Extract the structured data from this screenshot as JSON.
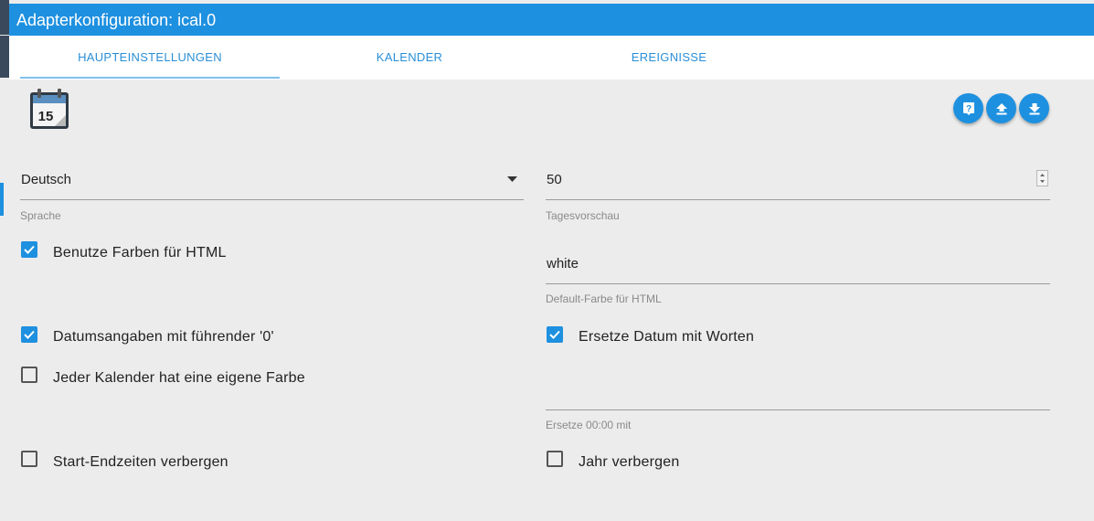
{
  "window": {
    "title": "Adapterkonfiguration: ical.0"
  },
  "tabs": [
    {
      "label": "HAUPTEINSTELLUNGEN",
      "active": true
    },
    {
      "label": "KALENDER",
      "active": false
    },
    {
      "label": "EREIGNISSE",
      "active": false
    }
  ],
  "logo": {
    "icon": "calendar-icon",
    "day": "15"
  },
  "toolbar": {
    "buttons": [
      {
        "icon": "help-icon"
      },
      {
        "icon": "upload-icon"
      },
      {
        "icon": "download-icon"
      }
    ]
  },
  "settings": {
    "language": {
      "value": "Deutsch",
      "helper": "Sprache"
    },
    "days_preview": {
      "value": "50",
      "helper": "Tagesvorschau"
    },
    "use_colors": {
      "label": "Benutze Farben für HTML",
      "checked": true
    },
    "default_color": {
      "value": "white",
      "helper": "Default-Farbe für HTML"
    },
    "leading_zero": {
      "label": "Datumsangaben mit führender '0'",
      "checked": true
    },
    "replace_date": {
      "label": "Ersetze Datum mit Worten",
      "checked": true
    },
    "own_color": {
      "label": "Jeder Kalender hat eine eigene Farbe",
      "checked": false
    },
    "replace_midnight": {
      "value": "",
      "helper": "Ersetze 00:00 mit"
    },
    "hide_times": {
      "label": "Start-Endzeiten verbergen",
      "checked": false
    },
    "hide_year": {
      "label": "Jahr verbergen",
      "checked": false
    }
  },
  "colors": {
    "accent": "#1e90e0",
    "background": "#ececec"
  }
}
